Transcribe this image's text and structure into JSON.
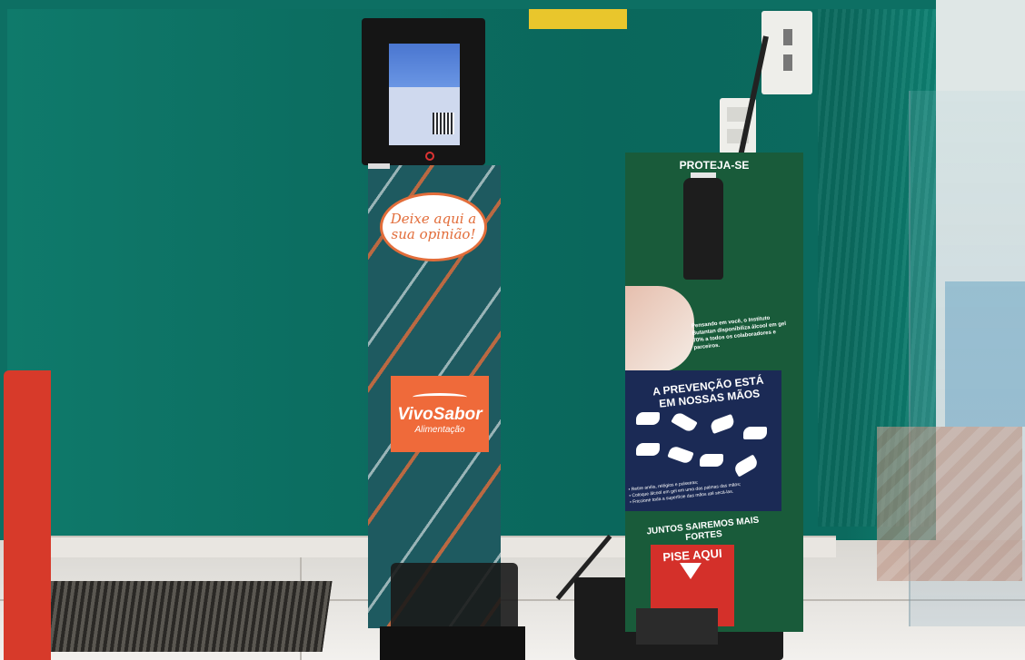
{
  "photo": {
    "kiosk": {
      "bubble_text_line1": "Deixe aqui a",
      "bubble_text_line2": "sua opinião!",
      "brand_name": "VivoSabor",
      "brand_sub": "Alimentação"
    },
    "dispenser": {
      "title": "PROTEJA-SE",
      "info_text": "Pensando em você, o Instituto Butantan disponibiliza álcool em gel 70% a todos os colaboradores e parceiros.",
      "panel_title_line1": "A PREVENÇÃO ESTÁ",
      "panel_title_line2": "EM NOSSAS MÃOS",
      "bullet_1": "• Retire anéis, relógios e pulseiras;",
      "bullet_2": "• Coloque álcool em gel em uma das palmas das mãos;",
      "bullet_3": "• Friccione toda a superfície das mãos até secá-las.",
      "slogan": "JUNTOS SAIREMOS MAIS FORTES",
      "pedal_label": "PISE AQUI"
    },
    "colors": {
      "wall": "#0c6e61",
      "kiosk_orange": "#ef6a3a",
      "dispenser_green": "#195b3a",
      "panel_navy": "#1b2a55",
      "pedal_red": "#d4302a"
    }
  }
}
